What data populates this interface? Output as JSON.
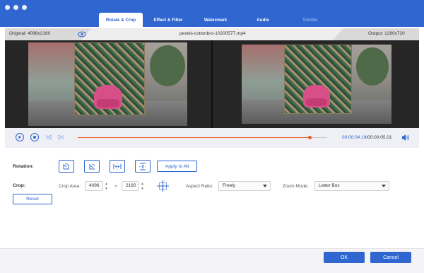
{
  "colors": {
    "accent": "#2f66cf",
    "progress": "#f05a28",
    "titlebar": "#2f66cf"
  },
  "tabs": [
    {
      "label": "Rotate & Crop"
    },
    {
      "label": "Effect & Filter"
    },
    {
      "label": "Watermark"
    },
    {
      "label": "Audio"
    },
    {
      "label": "Subtitle"
    }
  ],
  "info": {
    "original": "Original: 4096x2160",
    "filename": "pexels-cottonbro-10200577.mp4",
    "output": "Output: 1280x720",
    "eye_icon": "eye-icon"
  },
  "player": {
    "play_icon": "play-icon",
    "stop_icon": "stop-icon",
    "prev_icon": "skip-back-icon",
    "next_icon": "skip-forward-icon",
    "progress": 0.93,
    "time_current": "00:00:04.19",
    "time_total": "/00:00:05.01",
    "volume_icon": "volume-icon"
  },
  "rotation": {
    "label": "Rotation:",
    "apply_all": "Apply to All",
    "buttons": [
      "rotate-left-icon",
      "rotate-right-icon",
      "flip-horizontal-icon",
      "flip-vertical-icon"
    ]
  },
  "crop": {
    "label": "Crop:",
    "area_label": "Crop Area:",
    "width": "4096",
    "times": "×",
    "height": "2160",
    "crosshair_icon": "crosshair-icon",
    "aspect_label": "Aspect Ratio:",
    "aspect_value": "Freely",
    "zoom_label": "Zoom Mode:",
    "zoom_value": "Letter Box",
    "reset": "Reset"
  },
  "footer": {
    "ok": "OK",
    "cancel": "Cancel"
  }
}
